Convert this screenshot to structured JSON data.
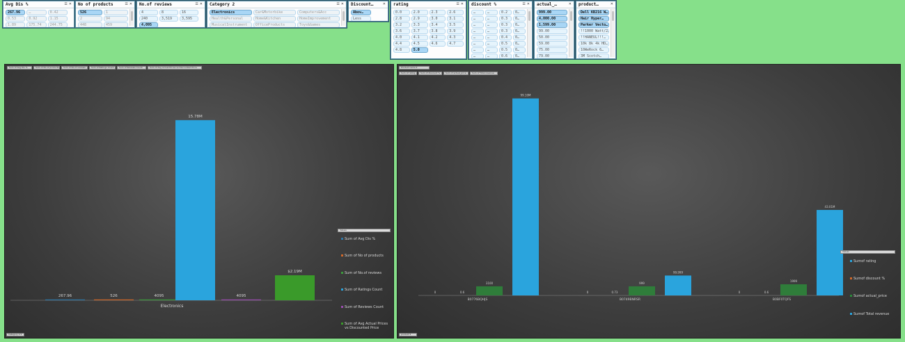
{
  "slicers": {
    "avg_dis": {
      "title": "Avg Dis %",
      "items": [
        "267.96",
        "…",
        "0.42",
        "0.53",
        "0.92",
        "1.15",
        "1.89",
        "175.74",
        "244.75"
      ]
    },
    "no_products": {
      "title": "No of products",
      "items": [
        "526",
        "1",
        "2",
        "94",
        "448",
        "459"
      ]
    },
    "no_reviews": {
      "title": "No.of reviews",
      "items": [
        "4",
        "8",
        "16",
        "240",
        "3,519",
        "3,595",
        "4,095"
      ]
    },
    "category": {
      "title": "Category 2",
      "items": [
        "Electronics",
        "Car&Motorbike",
        "Computers&Acc",
        "Health&Personal",
        "Home&Kitchen",
        "HomeImprovement",
        "MusicalInstrument",
        "OfficeProducts",
        "Toys&Games"
      ]
    },
    "discount": {
      "title": "Discount…",
      "items": [
        "Abov…",
        "Less"
      ]
    },
    "rating": {
      "title": "rating",
      "items": [
        "0.0",
        "2.0",
        "2.3",
        "2.6",
        "2.8",
        "2.9",
        "3.0",
        "3.1",
        "3.2",
        "3.3",
        "3.4",
        "3.5",
        "3.6",
        "3.7",
        "3.8",
        "3.9",
        "4.0",
        "4.1",
        "4.2",
        "4.3",
        "4.4",
        "4.5",
        "4.6",
        "4.7",
        "4.8",
        "5.0"
      ]
    },
    "discount_pct": {
      "title": "discount %",
      "items": [
        "…",
        "…",
        "0.2",
        "0…",
        "…",
        "…",
        "0.3",
        "0…",
        "…",
        "…",
        "0.3",
        "0…",
        "…",
        "…",
        "0.3",
        "0…",
        "…",
        "…",
        "0.4",
        "0…",
        "…",
        "…",
        "0.5",
        "0…",
        "…",
        "…",
        "0.5",
        "0…",
        "…",
        "…",
        "0.6",
        "0…"
      ]
    },
    "actual_price": {
      "title": "actual_…",
      "items": [
        "999.00",
        "4,000.00",
        "1,599.00",
        "99.00",
        "50.00",
        "59.00",
        "75.00",
        "79.00"
      ]
    },
    "product": {
      "title": "product…",
      "items": [
        "Dell KB216 W…",
        "Hair Hyper…",
        "Parker Vecto…",
        "!!1000 Watt/2…",
        "!!HANEUL!!!…",
        "10k 8k 4k HD…",
        "10WeRock 6…",
        "3M Scotch…"
      ]
    }
  },
  "chart1": {
    "field_buttons": [
      "Sum of Avg Dis %",
      "Sum of No of products",
      "Sum of No.of reviews",
      "Sum of Ratings Count",
      "Sum of Reviews Count",
      "Sum of Avg Actual Prices vs Discounted Price"
    ],
    "legend_title": "Values",
    "axis_field": "Category 2 ▾",
    "category_label": "Electronics"
  },
  "chart2": {
    "field_buttons": [
      "Sum of rating",
      "Sum of discount %",
      "Sum of actual_price",
      "Sum of Total revenue"
    ],
    "filter_button": "Product name ▾",
    "legend_title": "Values",
    "axis_field": "product ▾"
  },
  "chart_data": [
    {
      "type": "bar",
      "categories": [
        "Electronics"
      ],
      "series": [
        {
          "name": "Sum of Avg Dis %",
          "values": [
            267.96
          ],
          "color": "#2f78a8",
          "label": "267.96"
        },
        {
          "name": "Sum of No of products",
          "values": [
            526
          ],
          "color": "#d2692a",
          "label": "526"
        },
        {
          "name": "Sum of No.of reviews",
          "values": [
            4095
          ],
          "color": "#3c9a3c",
          "label": "4095"
        },
        {
          "name": "Sum of Ratings Count",
          "values": [
            15780000
          ],
          "color": "#2aa4dd",
          "label": "15.78M"
        },
        {
          "name": "Sum of Reviews Count",
          "values": [
            4095
          ],
          "color": "#9b4db0",
          "label": "4095"
        },
        {
          "name": "Sum of Avg Actual Prices vs Discounted Price",
          "values": [
            2190000
          ],
          "color": "#3a9a2a",
          "label": "$2.19M"
        }
      ],
      "ylim": [
        0,
        16500000
      ]
    },
    {
      "type": "bar",
      "categories": [
        "B0776BQHJS",
        "B0749BNRSR",
        "B0BF0TQFS"
      ],
      "series": [
        {
          "name": "Sumof rating",
          "values": [
            0,
            0,
            0
          ],
          "color": "#2aa4dd",
          "labels": [
            "0",
            "0",
            "0"
          ]
        },
        {
          "name": "Sumof discount %",
          "values": [
            0.6,
            0.73,
            0.6
          ],
          "color": "#d2692a",
          "labels": [
            "0.6",
            "0.73",
            "0.6"
          ]
        },
        {
          "name": "Sumof actual_price",
          "values": [
            3100,
            3099,
            5999
          ],
          "color": "#2a8a3a",
          "labels": [
            "3100",
            "999",
            "1999"
          ]
        },
        {
          "name": "Sumof Total revenue",
          "values": [
            99100,
            10000,
            43000
          ],
          "color": "#2aa4dd",
          "labels": [
            "99.10M",
            "99,999",
            "43.01M"
          ]
        }
      ],
      "ylim": [
        0,
        100000
      ]
    }
  ]
}
